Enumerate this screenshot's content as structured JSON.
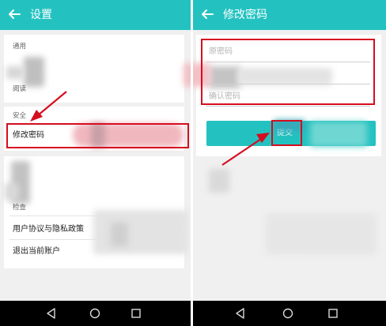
{
  "colors": {
    "accent": "#23c2c1",
    "annotation": "#d50d1f"
  },
  "left_screen": {
    "title": "设置",
    "back_icon": "arrow-left-icon",
    "sections": {
      "general_header": "通用",
      "general_partial": "阅读",
      "security_header": "安全",
      "change_password_item": "修改密码",
      "other_header": "检查",
      "privacy_item": "用户协议与隐私政策",
      "logout_item": "退出当前账户"
    }
  },
  "right_screen": {
    "title": "修改密码",
    "back_icon": "arrow-left-icon",
    "fields": {
      "old_password_placeholder": "原密码",
      "confirm_password_placeholder": "确认密码"
    },
    "submit_label": "提交"
  },
  "navbar": {
    "icons": [
      "back-triangle-icon",
      "home-circle-icon",
      "recents-square-icon"
    ]
  }
}
